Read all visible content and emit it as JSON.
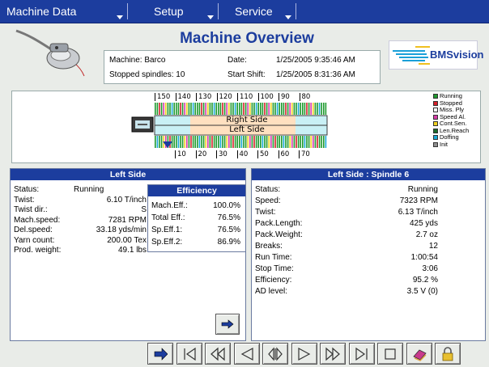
{
  "menu": {
    "machine_data": "Machine Data",
    "setup": "Setup",
    "service": "Service"
  },
  "header": {
    "title": "Machine Overview",
    "machine_label": "Machine: Barco",
    "stopped_label": "Stopped spindles: 10",
    "date_label": "Date:",
    "date_value": "1/25/2005 9:35:46 AM",
    "shift_label": "Start Shift:",
    "shift_value": "1/25/2005 8:31:36 AM",
    "logo_text": "BMSvision"
  },
  "diagram": {
    "top_ticks": [
      "150",
      "140",
      "130",
      "120",
      "110",
      "100",
      "90",
      "80"
    ],
    "bottom_ticks": [
      "10",
      "20",
      "30",
      "40",
      "50",
      "60",
      "70"
    ],
    "right_side": "Right Side",
    "left_side": "Left Side"
  },
  "legend": [
    {
      "label": "Running",
      "color": "#1f9a2f"
    },
    {
      "label": "Stopped",
      "color": "#d6202a"
    },
    {
      "label": "Miss. Ply",
      "color": "#ffffff"
    },
    {
      "label": "Speed Al.",
      "color": "#d63aa8"
    },
    {
      "label": "Cont.Sen.",
      "color": "#f0d020"
    },
    {
      "label": "Len.Reach",
      "color": "#1b6b2a"
    },
    {
      "label": "Doffing",
      "color": "#1aa9d6"
    },
    {
      "label": "Init",
      "color": "#909090"
    }
  ],
  "left_panel": {
    "title": "Left Side",
    "rows": [
      {
        "label": "Status:",
        "value": "Running"
      },
      {
        "label": "Twist:",
        "value": "6.10 T/inch"
      },
      {
        "label": "Twist dir.:",
        "value": "S"
      },
      {
        "label": "Mach.speed:",
        "value": "7281 RPM"
      },
      {
        "label": "Del.speed:",
        "value": "33.18 yds/min"
      },
      {
        "label": "Yarn count:",
        "value": "200.00 Tex"
      },
      {
        "label": "Prod. weight:",
        "value": "49.1 lbs"
      }
    ],
    "efficiency": {
      "title": "Efficiency",
      "rows": [
        {
          "label": "Mach.Eff.:",
          "value": "100.0%"
        },
        {
          "label": "Total Eff.:",
          "value": "76.5%"
        },
        {
          "label": "Sp.Eff.1:",
          "value": "76.5%"
        },
        {
          "label": "Sp.Eff.2:",
          "value": "86.9%"
        }
      ]
    }
  },
  "right_panel": {
    "title": "Left Side : Spindle 6",
    "rows": [
      {
        "label": "Status:",
        "value": "Running"
      },
      {
        "label": "Speed:",
        "value": "7323 RPM"
      },
      {
        "label": "Twist:",
        "value": "6.13 T/inch"
      },
      {
        "label": "Pack.Length:",
        "value": "425 yds"
      },
      {
        "label": "Pack.Weight:",
        "value": "2.7 oz"
      },
      {
        "label": "Breaks:",
        "value": "12"
      },
      {
        "label": "Run Time:",
        "value": "1:00:54"
      },
      {
        "label": "Stop Time:",
        "value": "3:06"
      },
      {
        "label": "Efficiency:",
        "value": "95.2 %"
      },
      {
        "label": "AD level:",
        "value": "3.5 V (0)"
      }
    ]
  },
  "toolbar": [
    "arrow-right-icon",
    "first-icon",
    "rewind-icon",
    "prev-icon",
    "swap-icon",
    "next-icon",
    "fast-forward-icon",
    "last-icon",
    "stop-icon",
    "book-icon",
    "lock-icon"
  ]
}
